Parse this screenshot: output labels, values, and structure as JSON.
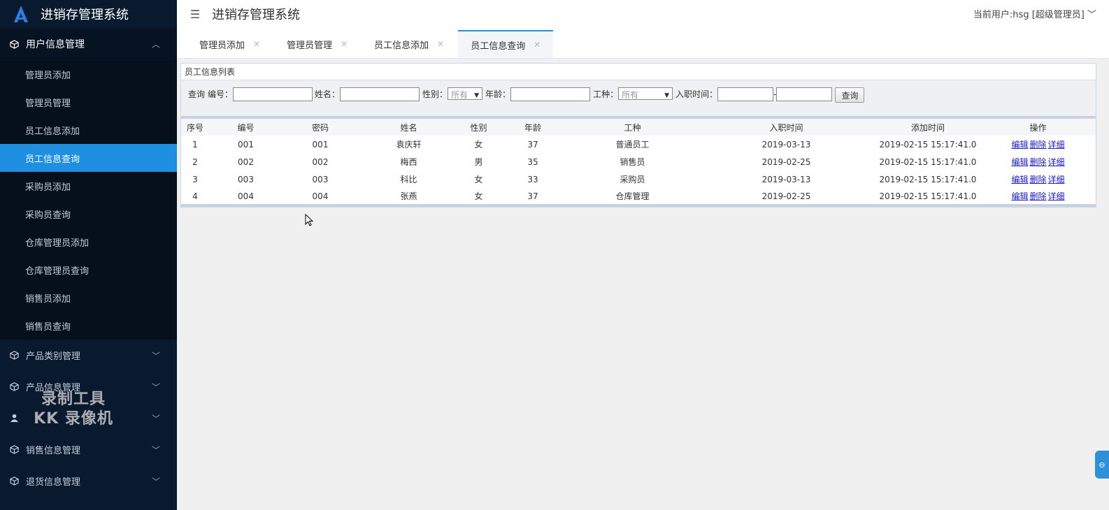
{
  "app": {
    "brand_title": "进销存管理系统",
    "header_title": "进销存管理系统",
    "current_user": "当前用户:hsg [超级管理员]"
  },
  "sidebar": {
    "group_open": {
      "label": "用户信息管理",
      "icon": "cube-icon"
    },
    "items": [
      {
        "label": "管理员添加"
      },
      {
        "label": "管理员管理"
      },
      {
        "label": "员工信息添加"
      },
      {
        "label": "员工信息查询",
        "active": true
      },
      {
        "label": "采购员添加"
      },
      {
        "label": "采购员查询"
      },
      {
        "label": "仓库管理员添加"
      },
      {
        "label": "仓库管理员查询"
      },
      {
        "label": "销售员添加"
      },
      {
        "label": "销售员查询"
      }
    ],
    "groups": [
      {
        "label": "产品类别管理",
        "icon": "cube-icon"
      },
      {
        "label": "产品信息管理",
        "icon": "cube-icon"
      },
      {
        "label": "",
        "icon": "user-icon"
      },
      {
        "label": "销售信息管理",
        "icon": "cube-icon"
      },
      {
        "label": "退货信息管理",
        "icon": "cube-icon"
      }
    ]
  },
  "tabs": [
    {
      "label": "管理员添加"
    },
    {
      "label": "管理员管理"
    },
    {
      "label": "员工信息添加"
    },
    {
      "label": "员工信息查询",
      "active": true
    }
  ],
  "panel": {
    "title": "员工信息列表",
    "search": {
      "query_label": "查询",
      "id_label": "编号：",
      "name_label": "姓名：",
      "gender_label": "性别：",
      "gender_value": "所有",
      "age_label": "年龄：",
      "job_label": "工种：",
      "job_value": "所有",
      "hire_label": "入职时间：",
      "hire_sep": "-",
      "button": "查询"
    },
    "columns": [
      "序号",
      "编号",
      "密码",
      "姓名",
      "性别",
      "年龄",
      "工种",
      "入职时间",
      "添加时间",
      "操作"
    ],
    "rows": [
      [
        "1",
        "001",
        "001",
        "袁庆轩",
        "女",
        "37",
        "普通员工",
        "2019-03-13",
        "2019-02-15 15:17:41.0"
      ],
      [
        "2",
        "002",
        "002",
        "梅西",
        "男",
        "35",
        "销售员",
        "2019-02-25",
        "2019-02-15 15:17:41.0"
      ],
      [
        "3",
        "003",
        "003",
        "科比",
        "女",
        "33",
        "采购员",
        "2019-03-13",
        "2019-02-15 15:17:41.0"
      ],
      [
        "4",
        "004",
        "004",
        "张燕",
        "女",
        "37",
        "仓库管理",
        "2019-02-25",
        "2019-02-15 15:17:41.0"
      ]
    ],
    "ops": {
      "edit": "编辑",
      "delete": "删除",
      "detail": "详细"
    }
  },
  "watermark": {
    "line1": "录制工具",
    "line2": "KK 录像机"
  },
  "colors": {
    "sidebar_bg": "#0a1a2e",
    "accent": "#1e8fe1"
  }
}
